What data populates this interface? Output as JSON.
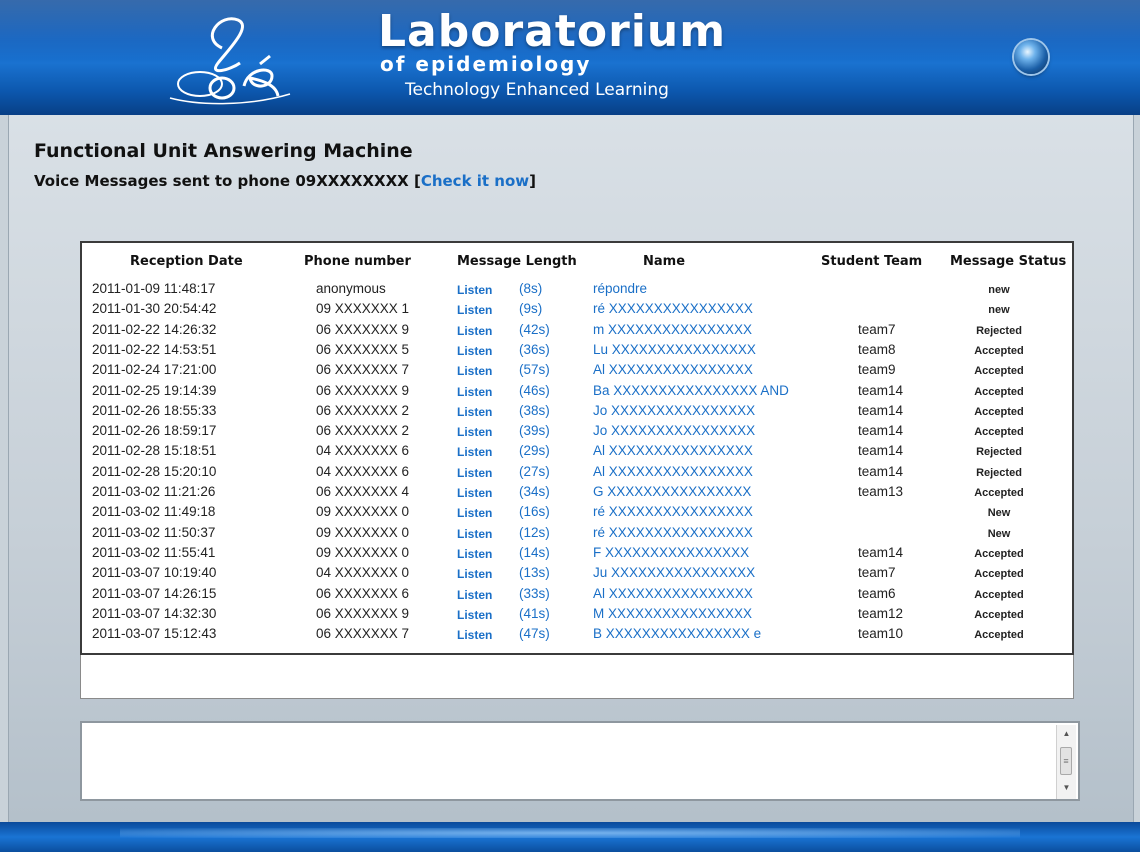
{
  "brand": {
    "title": "Laboratorium",
    "subtitle": "of epidemiology",
    "tagline": "Technology Enhanced Learning"
  },
  "page": {
    "title": "Functional Unit Answering Machine",
    "subtitle_prefix": "Voice Messages sent to phone 09XXXXXXXX  [",
    "check_link": "Check it now",
    "subtitle_suffix": "]"
  },
  "table": {
    "headers": [
      "Reception Date",
      "Phone number",
      "Message Length",
      "Name",
      "Student Team",
      "Message Status"
    ],
    "listen_label": "Listen",
    "rows": [
      {
        "date": "2011-01-09 11:48:17",
        "phone": "anonymous",
        "length": "(8s)",
        "name": "répondre",
        "team": "",
        "status": "new"
      },
      {
        "date": "2011-01-30 20:54:42",
        "phone": "09 XXXXXXX 1",
        "length": "(9s)",
        "name": "ré XXXXXXXXXXXXXXXX",
        "team": "",
        "status": "new"
      },
      {
        "date": "2011-02-22 14:26:32",
        "phone": "06 XXXXXXX 9",
        "length": "(42s)",
        "name": "m XXXXXXXXXXXXXXXX",
        "team": "team7",
        "status": "Rejected"
      },
      {
        "date": "2011-02-22 14:53:51",
        "phone": "06 XXXXXXX 5",
        "length": "(36s)",
        "name": "Lu XXXXXXXXXXXXXXXX",
        "team": "team8",
        "status": "Accepted"
      },
      {
        "date": "2011-02-24 17:21:00",
        "phone": "06 XXXXXXX 7",
        "length": "(57s)",
        "name": "Al XXXXXXXXXXXXXXXX",
        "team": "team9",
        "status": "Accepted"
      },
      {
        "date": "2011-02-25 19:14:39",
        "phone": "06 XXXXXXX 9",
        "length": "(46s)",
        "name": "Ba XXXXXXXXXXXXXXXX AND",
        "team": "team14",
        "status": "Accepted"
      },
      {
        "date": "2011-02-26 18:55:33",
        "phone": "06 XXXXXXX 2",
        "length": "(38s)",
        "name": "Jo XXXXXXXXXXXXXXXX",
        "team": "team14",
        "status": "Accepted"
      },
      {
        "date": "2011-02-26 18:59:17",
        "phone": "06 XXXXXXX 2",
        "length": "(39s)",
        "name": "Jo XXXXXXXXXXXXXXXX",
        "team": "team14",
        "status": "Accepted"
      },
      {
        "date": "2011-02-28 15:18:51",
        "phone": "04 XXXXXXX 6",
        "length": "(29s)",
        "name": "Al XXXXXXXXXXXXXXXX",
        "team": "team14",
        "status": "Rejected"
      },
      {
        "date": "2011-02-28 15:20:10",
        "phone": "04 XXXXXXX 6",
        "length": "(27s)",
        "name": "Al XXXXXXXXXXXXXXXX",
        "team": "team14",
        "status": "Rejected"
      },
      {
        "date": "2011-03-02 11:21:26",
        "phone": "06 XXXXXXX 4",
        "length": "(34s)",
        "name": "G XXXXXXXXXXXXXXXX",
        "team": "team13",
        "status": "Accepted"
      },
      {
        "date": "2011-03-02 11:49:18",
        "phone": "09 XXXXXXX 0",
        "length": "(16s)",
        "name": "ré XXXXXXXXXXXXXXXX",
        "team": "",
        "status": "New"
      },
      {
        "date": "2011-03-02 11:50:37",
        "phone": "09 XXXXXXX 0",
        "length": "(12s)",
        "name": "ré XXXXXXXXXXXXXXXX",
        "team": "",
        "status": "New"
      },
      {
        "date": "2011-03-02 11:55:41",
        "phone": "09 XXXXXXX 0",
        "length": "(14s)",
        "name": "F XXXXXXXXXXXXXXXX",
        "team": "team14",
        "status": "Accepted"
      },
      {
        "date": "2011-03-07 10:19:40",
        "phone": "04 XXXXXXX 0",
        "length": "(13s)",
        "name": "Ju XXXXXXXXXXXXXXXX",
        "team": "team7",
        "status": "Accepted"
      },
      {
        "date": "2011-03-07 14:26:15",
        "phone": "06 XXXXXXX 6",
        "length": "(33s)",
        "name": "Al XXXXXXXXXXXXXXXX",
        "team": "team6",
        "status": "Accepted"
      },
      {
        "date": "2011-03-07 14:32:30",
        "phone": "06 XXXXXXX 9",
        "length": "(41s)",
        "name": "M XXXXXXXXXXXXXXXX",
        "team": "team12",
        "status": "Accepted"
      },
      {
        "date": "2011-03-07 15:12:43",
        "phone": "06 XXXXXXX 7",
        "length": "(47s)",
        "name": "B XXXXXXXXXXXXXXXX e",
        "team": "team10",
        "status": "Accepted"
      }
    ]
  },
  "colors": {
    "header_blue": "#0d5fbf",
    "link_blue": "#1a6fc7"
  },
  "icons": {
    "logo": "loe-logo",
    "orb": "round-orb-button-icon"
  }
}
